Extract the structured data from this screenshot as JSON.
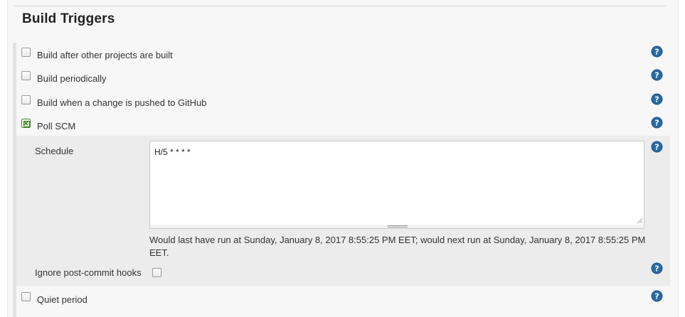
{
  "section": {
    "title": "Build Triggers"
  },
  "triggers": {
    "after_other": {
      "label": "Build after other projects are built",
      "checked": false
    },
    "periodically": {
      "label": "Build periodically",
      "checked": false
    },
    "github_push": {
      "label": "Build when a change is pushed to GitHub",
      "checked": false
    },
    "poll_scm": {
      "label": "Poll SCM",
      "checked": true
    },
    "quiet_period": {
      "label": "Quiet period",
      "checked": false
    }
  },
  "poll": {
    "schedule_label": "Schedule",
    "schedule_value": "H/5 * * * *",
    "schedule_info": "Would last have run at Sunday, January 8, 2017 8:55:25 PM EET; would next run at Sunday, January 8, 2017 8:55:25 PM EET.",
    "ignore_hooks_label": "Ignore post-commit hooks",
    "ignore_hooks_checked": false
  },
  "icons": {
    "help": "help-icon"
  },
  "colors": {
    "help_blue": "#2b6aa6",
    "checked_green": "#4a8a3a"
  }
}
